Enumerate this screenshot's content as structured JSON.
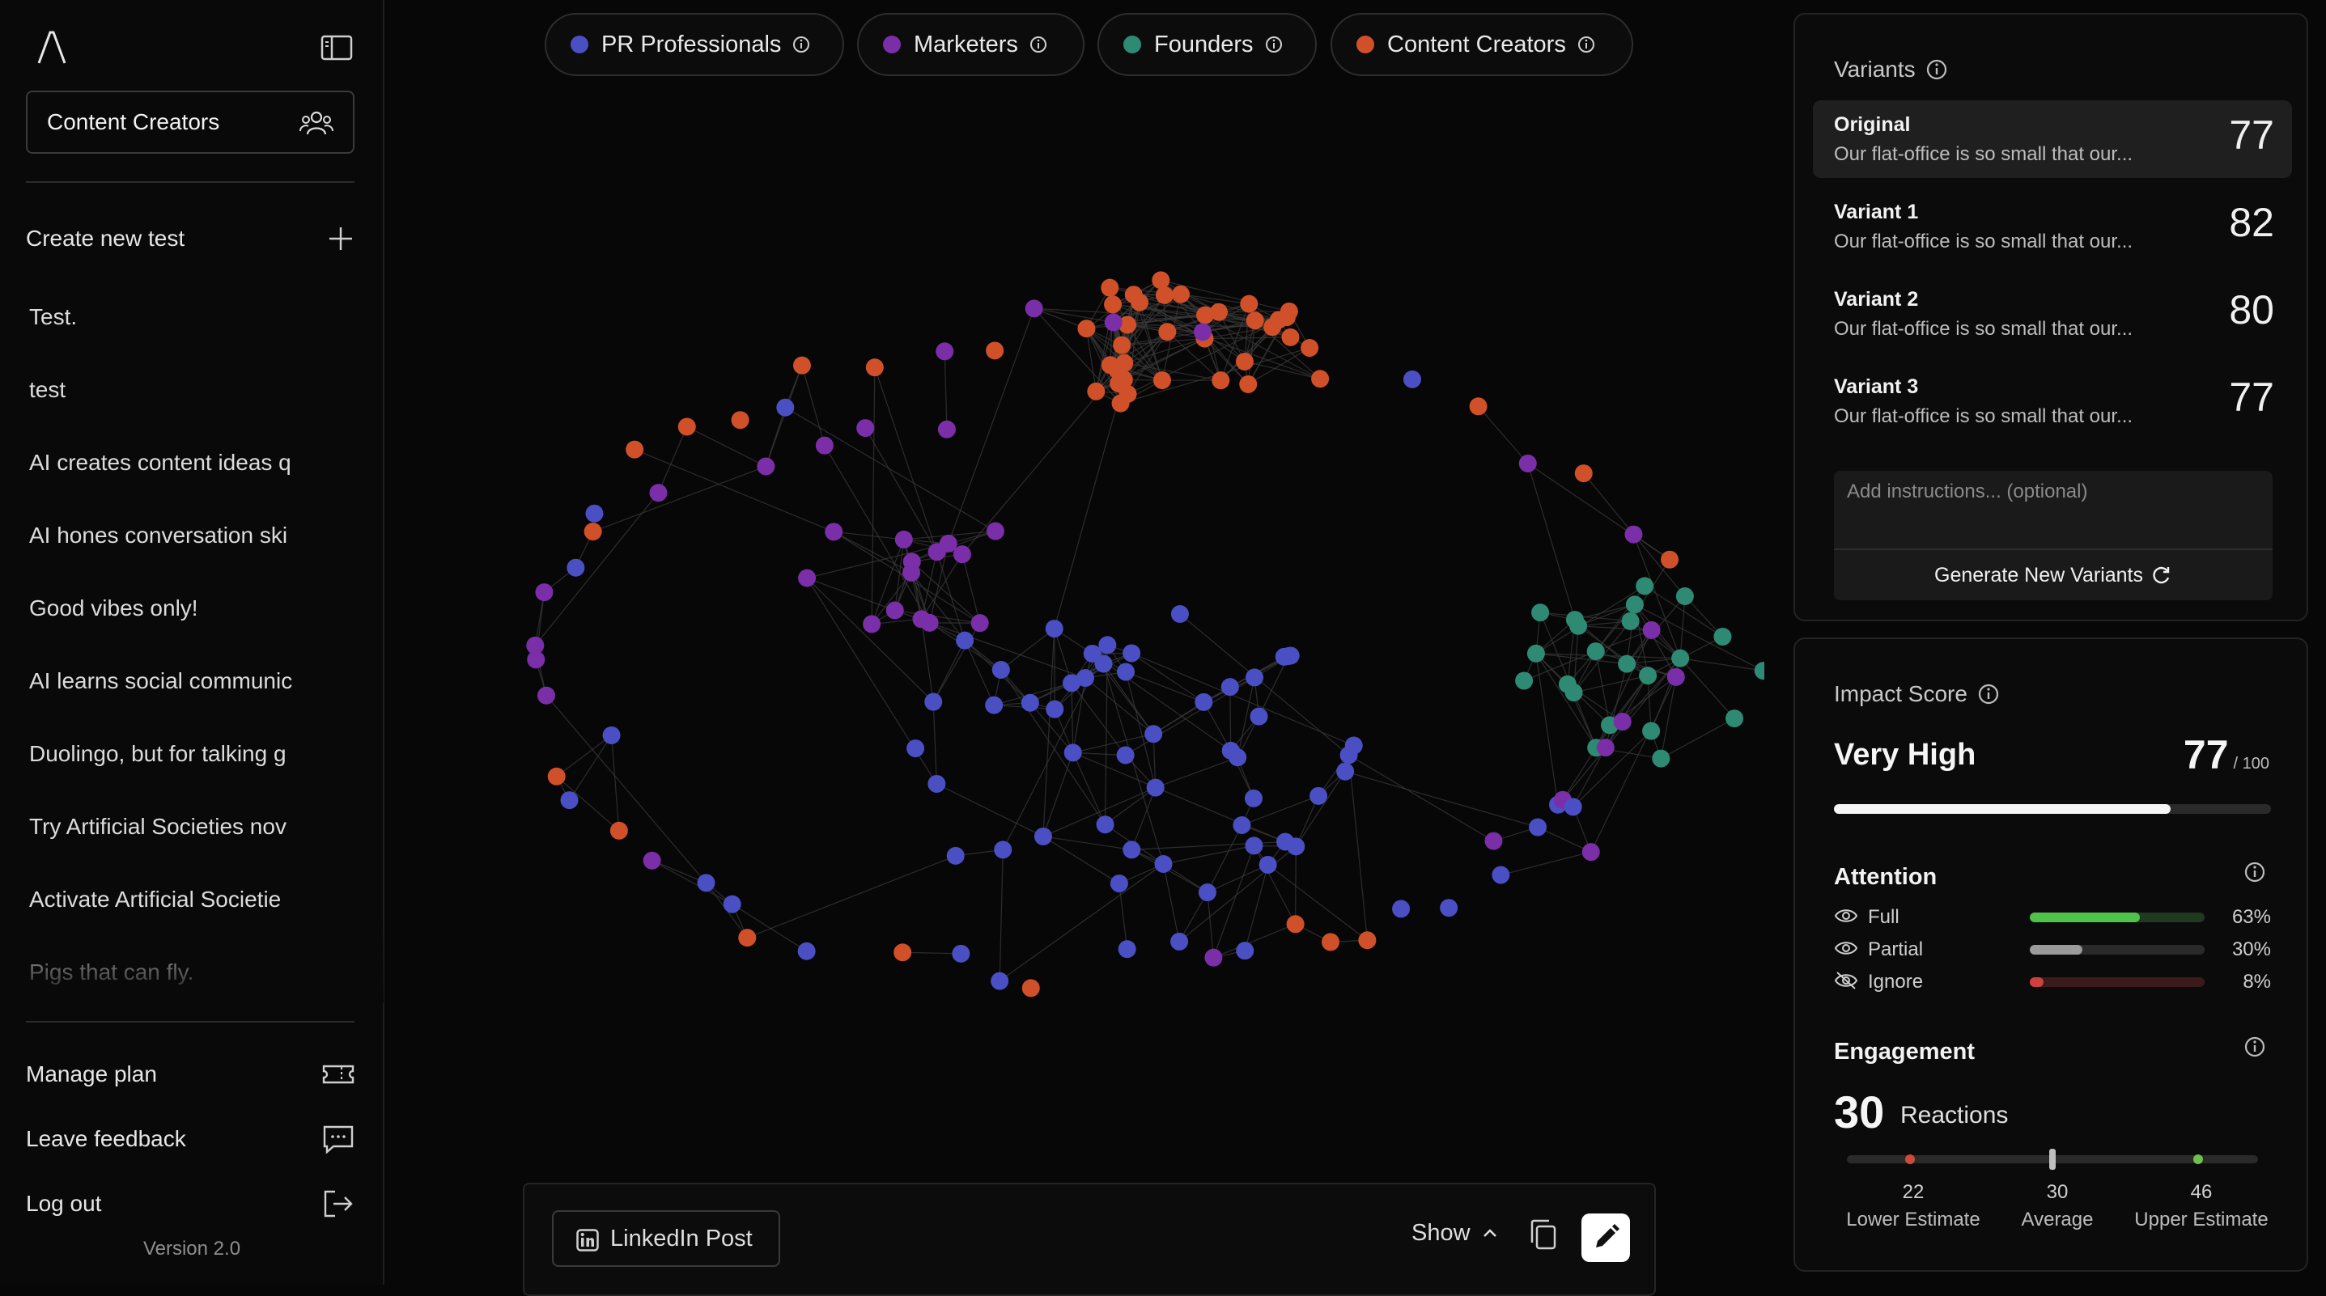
{
  "sidebar": {
    "audience": "Content Creators",
    "create_label": "Create new test",
    "history": [
      "Test.",
      "test",
      "AI creates content ideas q",
      "AI hones conversation ski",
      "Good vibes only!",
      "AI learns social communic",
      "Duolingo, but for talking g",
      "Try Artificial Societies nov",
      "Activate Artificial Societie",
      "Pigs that can fly."
    ],
    "manage_plan": "Manage plan",
    "leave_feedback": "Leave feedback",
    "log_out": "Log out",
    "version": "Version 2.0"
  },
  "segments": [
    {
      "label": "PR Professionals",
      "color": "#4a4fc4"
    },
    {
      "label": "Marketers",
      "color": "#7a2ea8"
    },
    {
      "label": "Founders",
      "color": "#2f8a74"
    },
    {
      "label": "Content Creators",
      "color": "#d0502a"
    }
  ],
  "bottom_bar": {
    "post_type": "LinkedIn Post",
    "show_label": "Show"
  },
  "variants": {
    "title": "Variants",
    "items": [
      {
        "name": "Original",
        "text": "Our flat-office is so small that our...",
        "score": "77"
      },
      {
        "name": "Variant 1",
        "text": "Our flat-office is so small that our...",
        "score": "82"
      },
      {
        "name": "Variant 2",
        "text": "Our flat-office is so small that our...",
        "score": "80"
      },
      {
        "name": "Variant 3",
        "text": "Our flat-office is so small that our...",
        "score": "77"
      }
    ],
    "instructions_placeholder": "Add instructions... (optional)",
    "generate_label": "Generate New Variants"
  },
  "impact": {
    "title": "Impact Score",
    "level": "Very High",
    "score": "77",
    "max": "/ 100",
    "fraction": 0.77
  },
  "attention": {
    "title": "Attention",
    "rows": [
      {
        "label": "Full",
        "pct": "63%",
        "value": 0.63,
        "color": "#4fc24a",
        "track": "#1f3a1f"
      },
      {
        "label": "Partial",
        "pct": "30%",
        "value": 0.3,
        "color": "#9a9a9a",
        "track": "#2a2a2a"
      },
      {
        "label": "Ignore",
        "pct": "8%",
        "value": 0.08,
        "color": "#d04040",
        "track": "#3a1a1a"
      }
    ]
  },
  "engagement": {
    "title": "Engagement",
    "count": "30",
    "unit": "Reactions",
    "lower": "22",
    "average": "30",
    "upper": "46",
    "lower_label": "Lower Estimate",
    "average_label": "Average",
    "upper_label": "Upper Estimate"
  }
}
